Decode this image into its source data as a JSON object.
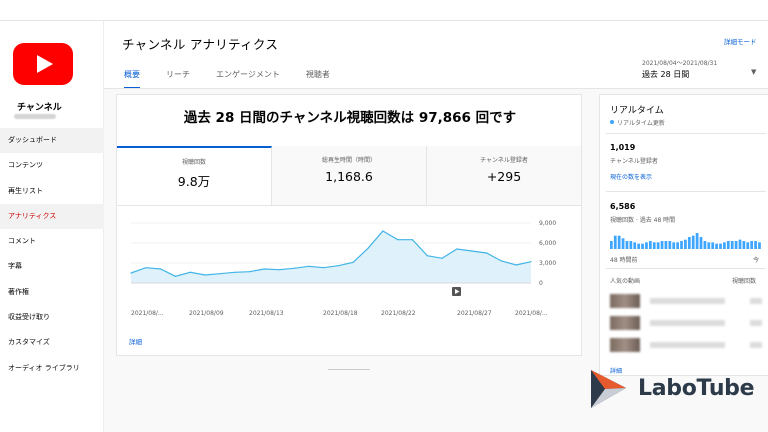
{
  "sidebar": {
    "channel_label": "チャンネル",
    "items": [
      {
        "label": "ダッシュボード"
      },
      {
        "label": "コンテンツ"
      },
      {
        "label": "再生リスト"
      },
      {
        "label": "アナリティクス"
      },
      {
        "label": "コメント"
      },
      {
        "label": "字幕"
      },
      {
        "label": "著作権"
      },
      {
        "label": "収益受け取り"
      },
      {
        "label": "カスタマイズ"
      },
      {
        "label": "オーディオ ライブラリ"
      }
    ]
  },
  "header": {
    "title": "チャンネル アナリティクス",
    "detail_mode": "詳細モード",
    "tabs": [
      {
        "label": "概要"
      },
      {
        "label": "リーチ"
      },
      {
        "label": "エンゲージメント"
      },
      {
        "label": "視聴者"
      }
    ],
    "date_range": "2021/08/04～2021/08/31",
    "date_label": "過去 28 日間"
  },
  "main": {
    "headline": "過去 28 日間のチャンネル視聴回数は 97,866 回です",
    "metrics": [
      {
        "label": "視聴回数",
        "value": "9.8万"
      },
      {
        "label": "総再生時間（時間）",
        "value": "1,168.6"
      },
      {
        "label": "チャンネル登録者",
        "value": "+295"
      }
    ],
    "detail_link": "詳細"
  },
  "chart_data": {
    "type": "area",
    "x": [
      "2021/08/04",
      "2021/08/05",
      "2021/08/06",
      "2021/08/07",
      "2021/08/08",
      "2021/08/09",
      "2021/08/10",
      "2021/08/11",
      "2021/08/12",
      "2021/08/13",
      "2021/08/14",
      "2021/08/15",
      "2021/08/16",
      "2021/08/17",
      "2021/08/18",
      "2021/08/19",
      "2021/08/20",
      "2021/08/21",
      "2021/08/22",
      "2021/08/23",
      "2021/08/24",
      "2021/08/25",
      "2021/08/26",
      "2021/08/27",
      "2021/08/28",
      "2021/08/29",
      "2021/08/30",
      "2021/08/31"
    ],
    "values": [
      1500,
      2300,
      2100,
      1000,
      1600,
      1200,
      1400,
      1600,
      1700,
      2100,
      2000,
      2200,
      2500,
      2300,
      2600,
      3100,
      5200,
      7800,
      6500,
      6500,
      4100,
      3700,
      5100,
      4800,
      4500,
      3300,
      2700,
      3200
    ],
    "xtick_labels": [
      "2021/08/...",
      "2021/08/09",
      "2021/08/13",
      "2021/08/18",
      "2021/08/22",
      "2021/08/27",
      "2021/08/..."
    ],
    "yticks": [
      "9,000",
      "6,000",
      "3,000",
      "0"
    ],
    "ylim": [
      0,
      9000
    ],
    "fill_color": "#dff2fb",
    "line_color": "#41b4e6"
  },
  "realtime": {
    "title": "リアルタイム",
    "subtitle": "リアルタイム更新",
    "subscribers_value": "1,019",
    "subscribers_label": "チャンネル登録者",
    "show_now_link": "現在の数を表示",
    "views_value": "6,586",
    "views_label": "視聴回数 · 過去 48 時間",
    "axis_left": "48 時間前",
    "axis_right": "今",
    "popular_label": "人気の動画",
    "views_col_label": "視聴回数",
    "detail_link": "詳細",
    "bar_values": [
      6,
      10,
      10,
      8,
      6,
      6,
      5,
      4,
      4,
      5,
      6,
      5,
      5,
      6,
      6,
      6,
      5,
      5,
      6,
      7,
      9,
      10,
      12,
      9,
      6,
      5,
      5,
      4,
      4,
      5,
      6,
      6,
      6,
      7,
      6,
      5,
      6,
      6,
      5
    ],
    "bar_color": "#3ea6ff"
  },
  "watermark": {
    "text": "LaboTube"
  }
}
